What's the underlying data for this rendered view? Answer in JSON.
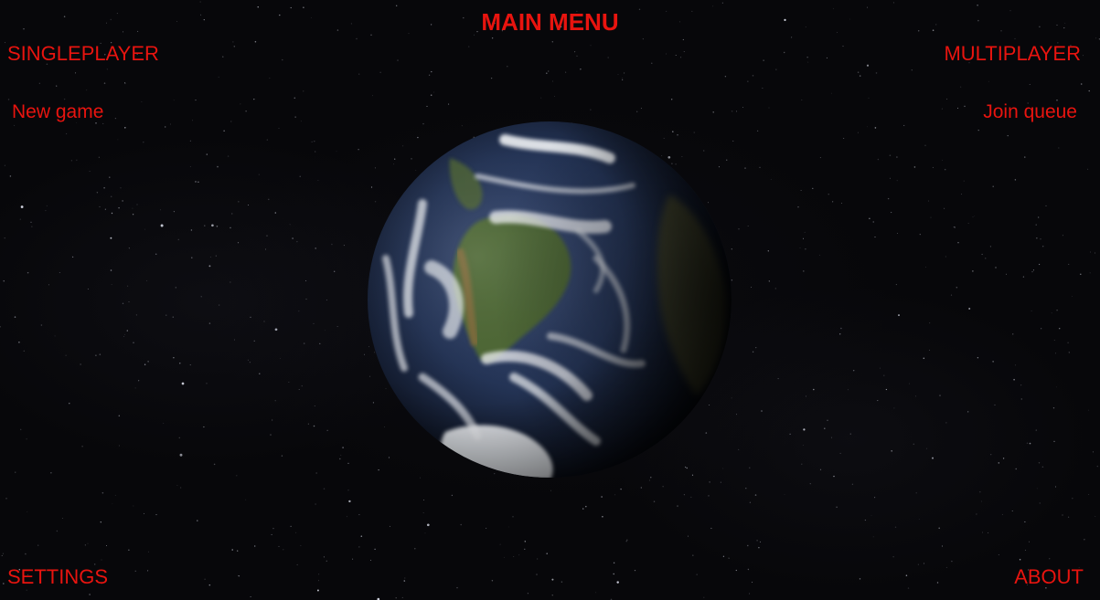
{
  "menu": {
    "title": "MAIN MENU",
    "singleplayer": {
      "heading": "SINGLEPLAYER",
      "new_game": "New game"
    },
    "multiplayer": {
      "heading": "MULTIPLAYER",
      "join_queue": "Join queue"
    },
    "settings": "SETTINGS",
    "about": "ABOUT"
  },
  "colors": {
    "menu_text": "#e8140f",
    "background": "#07070a"
  }
}
